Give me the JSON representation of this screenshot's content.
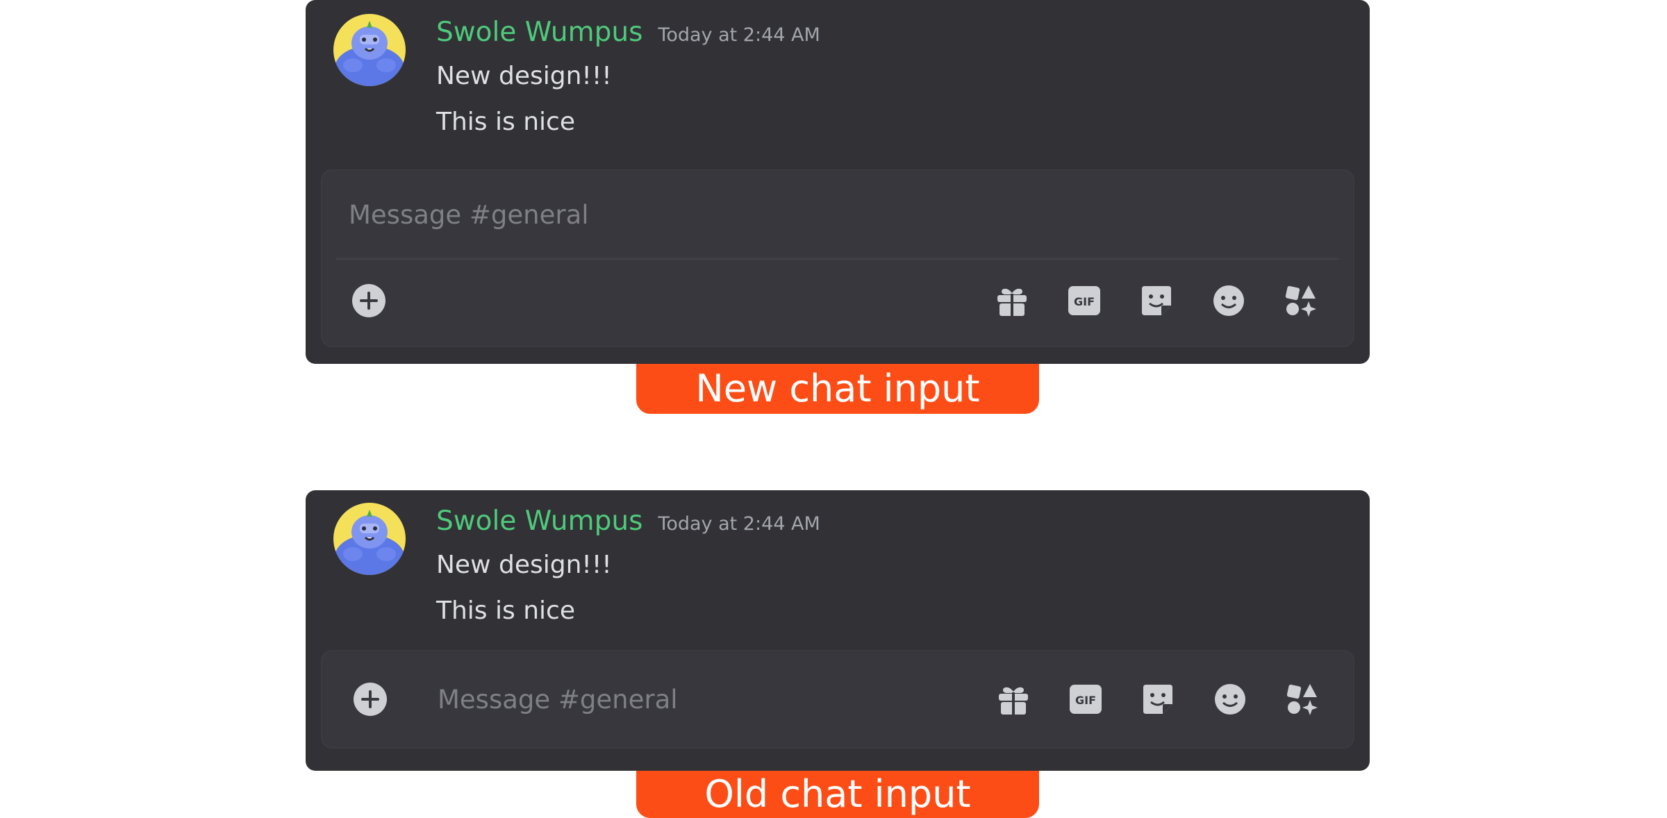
{
  "colors": {
    "panel_bg": "#313136",
    "input_bg": "#37373d",
    "username": "#4fca7b",
    "badge": "#fd4d17",
    "icon": "#cfd0d4"
  },
  "new_design": {
    "message": {
      "username": "Swole Wumpus",
      "timestamp": "Today at 2:44 AM",
      "lines": [
        "New design!!!",
        "This is nice"
      ]
    },
    "input": {
      "placeholder": "Message #general"
    },
    "toolbar_icons": [
      "plus-circle-icon",
      "gift-icon",
      "gif-icon",
      "sticker-icon",
      "emoji-icon",
      "apps-icon"
    ],
    "badge_label": "New chat input"
  },
  "old_design": {
    "message": {
      "username": "Swole Wumpus",
      "timestamp": "Today at 2:44 AM",
      "lines": [
        "New design!!!",
        "This is nice"
      ]
    },
    "input": {
      "placeholder": "Message #general"
    },
    "toolbar_icons": [
      "plus-circle-icon",
      "gift-icon",
      "gif-icon",
      "sticker-icon",
      "emoji-icon",
      "apps-icon"
    ],
    "badge_label": "Old chat input"
  },
  "icons": {
    "gif_text": "GIF"
  }
}
